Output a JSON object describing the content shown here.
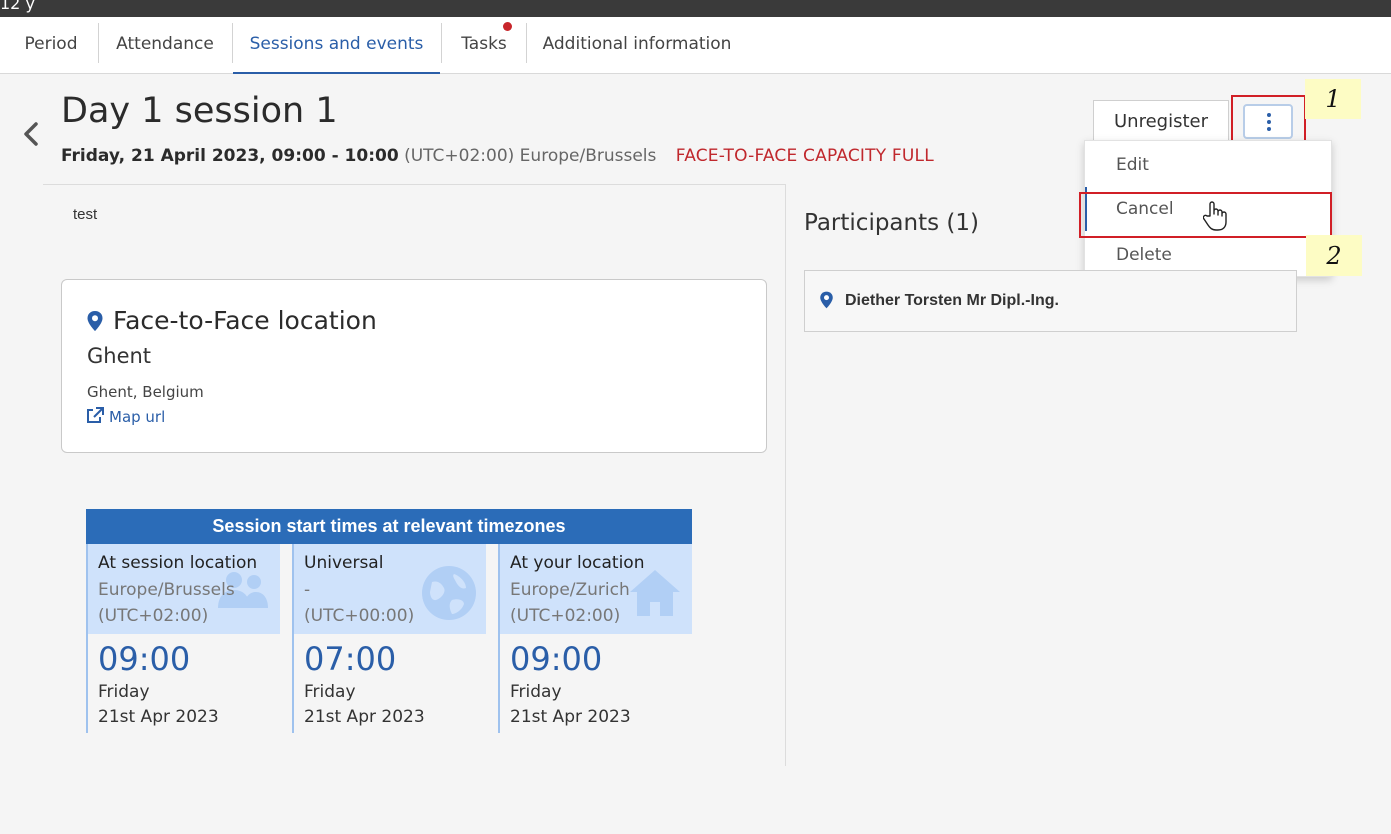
{
  "topbar": {
    "fragment": "12 y"
  },
  "tabs": [
    {
      "label": "Period"
    },
    {
      "label": "Attendance"
    },
    {
      "label": "Sessions and events",
      "active": true
    },
    {
      "label": "Tasks",
      "has_notification": true
    },
    {
      "label": "Additional information"
    }
  ],
  "session": {
    "title": "Day 1 session 1",
    "datetime": "Friday, 21 April 2023, 09:00 - 10:00",
    "timezone": "(UTC+02:00) Europe/Brussels",
    "capacity_status": "FACE-TO-FACE CAPACITY FULL",
    "description": "test"
  },
  "actions": {
    "unregister_label": "Unregister",
    "more_icon": "kebab-icon",
    "menu": [
      {
        "label": "Edit"
      },
      {
        "label": "Cancel",
        "focused": true
      },
      {
        "label": "Delete"
      }
    ]
  },
  "annotations": {
    "step1": "1",
    "step2": "2"
  },
  "location": {
    "heading": "Face-to-Face location",
    "name": "Ghent",
    "address": "Ghent, Belgium",
    "map_link": "Map url",
    "pin_icon": "map-pin-icon",
    "map_icon": "external-link-icon"
  },
  "timezones": {
    "heading": "Session start times at relevant timezones",
    "columns": [
      {
        "label": "At session location",
        "zone": "Europe/Brussels",
        "offset": "(UTC+02:00)",
        "time": "09:00",
        "day": "Friday",
        "date": "21st Apr 2023",
        "icon": "group-icon"
      },
      {
        "label": "Universal",
        "zone": "-",
        "offset": "(UTC+00:00)",
        "time": "07:00",
        "day": "Friday",
        "date": "21st Apr 2023",
        "icon": "globe-icon"
      },
      {
        "label": "At your location",
        "zone": "Europe/Zurich",
        "offset": "(UTC+02:00)",
        "time": "09:00",
        "day": "Friday",
        "date": "21st Apr 2023",
        "icon": "home-icon"
      }
    ]
  },
  "participants": {
    "title": "Participants (1)",
    "items": [
      {
        "name": "Diether Torsten Mr Dipl.-Ing."
      }
    ]
  },
  "colors": {
    "accent": "#2a5ea8",
    "alert": "#c0282d",
    "highlight_border": "#d11f26",
    "note_bg": "#fdfcc4",
    "tz_header": "#2b6cb8",
    "tz_panel": "#cfe2fb"
  }
}
